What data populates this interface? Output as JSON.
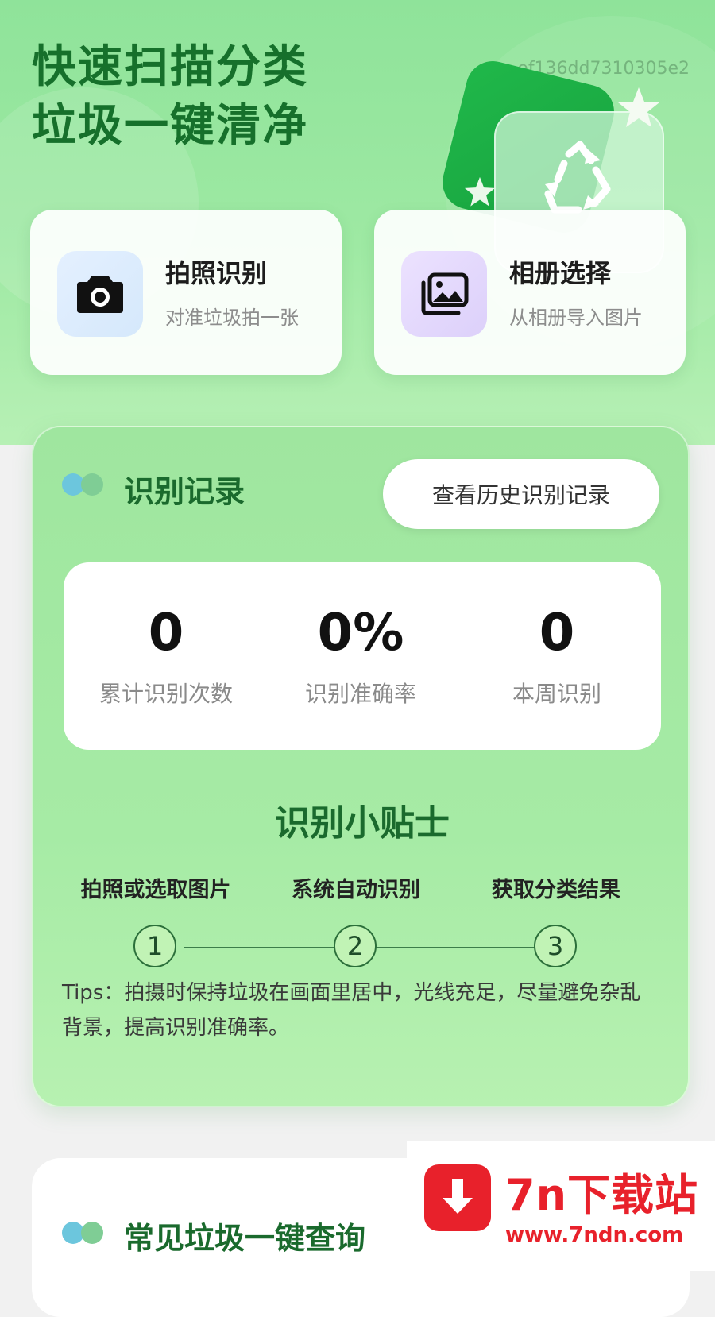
{
  "hero": {
    "title_line1": "快速扫描分类",
    "title_line2": "垃圾一键清净",
    "id_text": "ef136dd7310305e2"
  },
  "actions": [
    {
      "title": "拍照识别",
      "subtitle": "对准垃圾拍一张",
      "icon": "camera-icon"
    },
    {
      "title": "相册选择",
      "subtitle": "从相册导入图片",
      "icon": "gallery-icon"
    }
  ],
  "records": {
    "title": "识别记录",
    "history_button": "查看历史识别记录",
    "stats": [
      {
        "value": "0",
        "label": "累计识别次数"
      },
      {
        "value": "0%",
        "label": "识别准确率"
      },
      {
        "value": "0",
        "label": "本周识别"
      }
    ]
  },
  "tips": {
    "title": "识别小贴士",
    "steps": [
      {
        "label": "拍照或选取图片",
        "number": "1"
      },
      {
        "label": "系统自动识别",
        "number": "2"
      },
      {
        "label": "获取分类结果",
        "number": "3"
      }
    ],
    "text": "Tips：拍摄时保持垃圾在画面里居中，光线充足，尽量避免杂乱背景，提高识别准确率。"
  },
  "common": {
    "title": "常见垃圾一键查询"
  },
  "watermark": {
    "name": "7n下载站",
    "url": "www.7ndn.com"
  },
  "colors": {
    "primary_green": "#1a6a2d",
    "hero_green": "#9ee9a3",
    "watermark_red": "#e8212b"
  }
}
